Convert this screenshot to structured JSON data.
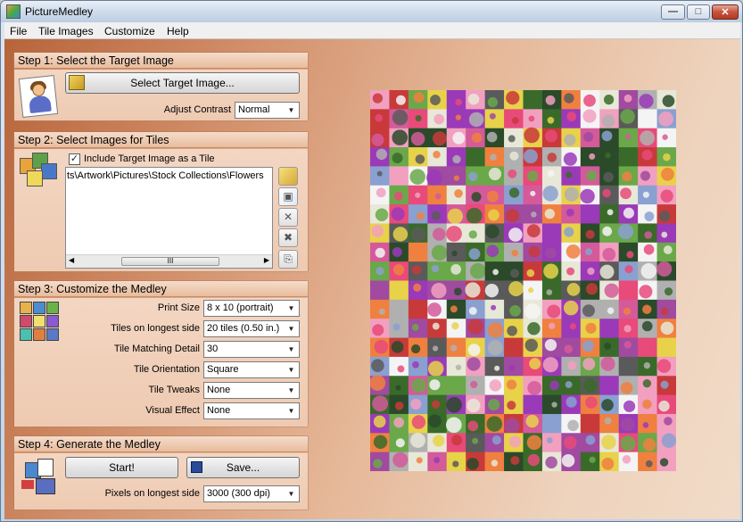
{
  "window": {
    "title": "PictureMedley"
  },
  "window_buttons": {
    "minimize": "—",
    "maximize": "□",
    "close": "✕"
  },
  "menu": [
    "File",
    "Tile Images",
    "Customize",
    "Help"
  ],
  "step1": {
    "title": "Step 1: Select the Target Image",
    "select_button": "Select Target Image...",
    "contrast_label": "Adjust Contrast",
    "contrast_value": "Normal"
  },
  "step2": {
    "title": "Step 2: Select Images for Tiles",
    "include_label": "Include Target Image as a Tile",
    "include_checked": true,
    "folders": [
      "ts\\Artwork\\Pictures\\Stock Collections\\Flowers"
    ],
    "scroll_grip": "III"
  },
  "step3": {
    "title": "Step 3: Customize the Medley",
    "fields": [
      {
        "label": "Print Size",
        "value": "8 x 10 (portrait)"
      },
      {
        "label": "Tiles on longest side",
        "value": "20 tiles (0.50 in.)"
      },
      {
        "label": "Tile Matching Detail",
        "value": "30"
      },
      {
        "label": "Tile Orientation",
        "value": "Square"
      },
      {
        "label": "Tile Tweaks",
        "value": "None"
      },
      {
        "label": "Visual Effect",
        "value": "None"
      }
    ]
  },
  "step4": {
    "title": "Step 4: Generate the Medley",
    "start_button": "Start!",
    "save_button": "Save...",
    "pixels_label": "Pixels on longest side",
    "pixels_value": "3000 (300 dpi)"
  },
  "icons": {
    "app": "picturemedley-app-icon",
    "browse": "folder-image-icon",
    "add_folder": "add-folder-icon",
    "add_image": "add-image-icon",
    "remove": "remove-icon",
    "remove_all": "remove-all-icon",
    "paste": "paste-icon",
    "save": "floppy-disk-icon"
  },
  "colors": {
    "accent_panel": "#e8bc9c",
    "background_gradient_start": "#b7643a",
    "background_gradient_end": "#f1dbc8"
  }
}
